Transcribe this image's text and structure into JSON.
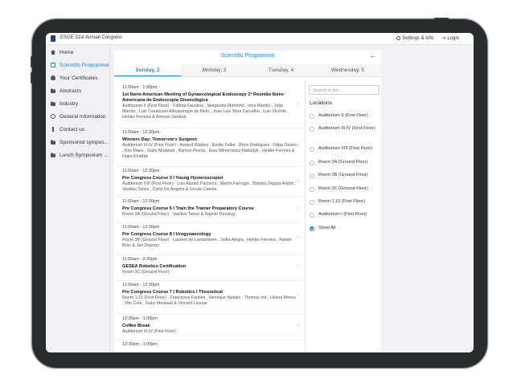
{
  "app": {
    "title": "ESGE 31st Annual Congress",
    "settings": "Settings & Info",
    "login": "Login"
  },
  "sidebar": {
    "items": [
      {
        "label": "Home",
        "icon": "home-icon"
      },
      {
        "label": "Scientific Programme",
        "icon": "calendar-icon",
        "active": true
      },
      {
        "label": "Your Certificates",
        "icon": "user-icon"
      },
      {
        "label": "Abstracts",
        "icon": "folder-icon"
      },
      {
        "label": "Industry",
        "icon": "folder-icon"
      },
      {
        "label": "General Information",
        "icon": "info-icon"
      },
      {
        "label": "Contact us",
        "icon": "info-i-icon"
      },
      {
        "label": "Sponsored sympos...",
        "icon": "folder-icon"
      },
      {
        "label": "Lunch Symposium ...",
        "icon": "folder-icon"
      }
    ]
  },
  "main": {
    "title": "Scientific Programme",
    "tabs": [
      "Sunday, 2",
      "Monday, 3",
      "Tuesday, 4",
      "Wednesday, 5"
    ],
    "sessions": [
      {
        "time": "11:00am - 1:30pm",
        "title": "1st Ibero-American Meeting of Gynaecological Endoscopy 1º Reunião Ibero-Americana de Endoscopia Ginecológica",
        "detail": "Auditorium II (First Floor) · Fátima Faustino , Margarida Martinho , Irina Ramilo , João Maroto , Luiz Cavalcanti Albuquerque de Neto , Joao Luis Silva Carvalho , Luis Vicente , Helder Ferreira & Antonio Setúbal"
      },
      {
        "time": "11:00am - 12:30pm",
        "title": "Winners Day: Tomorrow's Surgeon",
        "detail": "Auditorium III-IV (First Floor) · Arnaud Wattiez , Emilie Faller , Brice Rodriguez , Filipa Osorio , Kris Maes , Gaby Moawad , Ramon Rovira , Ewa Milnerowicz-Nabzdyk , Helder Ferreira & Hajra Khattak"
      },
      {
        "time": "11:00am - 12:30pm",
        "title": "Pre Congress Course 3 I Young Hysteroscopist",
        "detail": "Auditorium VIII (First Floor) · Luis Alonso Pacheco , Martin Farrugia , Branka Zegura Andric , Vasilios Tanos , Carlo De Angelis & Ursula Catena"
      },
      {
        "time": "11:00am - 12:30pm",
        "title": "Pre Congress Course 5 I Train the Trainer Preparatory Course",
        "detail": "Room 3A (Ground Floor) · Vasilios Tanos & Rajesh Devassy"
      },
      {
        "time": "11:00am - 12:30pm",
        "title": "Pre Congress Course 8 I Urogynaecology",
        "detail": "Room 3B (Ground Floor) · Laurent de Landsheere , Sofia Alegra , Helder Ferreira , Rafael Brás & Jan Deprest"
      },
      {
        "time": "11:00am - 2:30pm",
        "title": "GESEA Robotics Certification",
        "detail": "Room 3C (Ground Floor)"
      },
      {
        "time": "11:00am - 12:30pm",
        "title": "Pre Congress Course 7 I Robotics I Theoretical",
        "detail": "Room 1.15 (First Floor) · Francesco Fanfani , Henrique Nabais , Thomas Ind , Liliana Mereu , Vito Cela , Gaby Moawad & Vincent Lavoue"
      },
      {
        "time": "12:30pm - 1:00pm",
        "title": "Coffee Break",
        "detail": "Auditorium III-IV (First Floor)"
      },
      {
        "time": "12:30pm - 1:00pm",
        "title": "",
        "detail": ""
      }
    ]
  },
  "filter": {
    "search_placeholder": "Search in list...",
    "locations_header": "Locations",
    "locations": [
      "Auditorium II (First Floor)",
      "Auditorium III-IV (First Floor)",
      "Auditorium VIII (First Floor)",
      "Room 3A (Ground Floor)",
      "Room 3B (Ground Floor)",
      "Room 3C (Ground Floor)",
      "Room 1.15 (First Floor)",
      "Auditorium I (First Floor)",
      "Show All"
    ],
    "selected": "Show All"
  },
  "colors": {
    "accent": "#1e88e5",
    "device": "#2a2b2d",
    "logo": "#1b3f8a"
  }
}
